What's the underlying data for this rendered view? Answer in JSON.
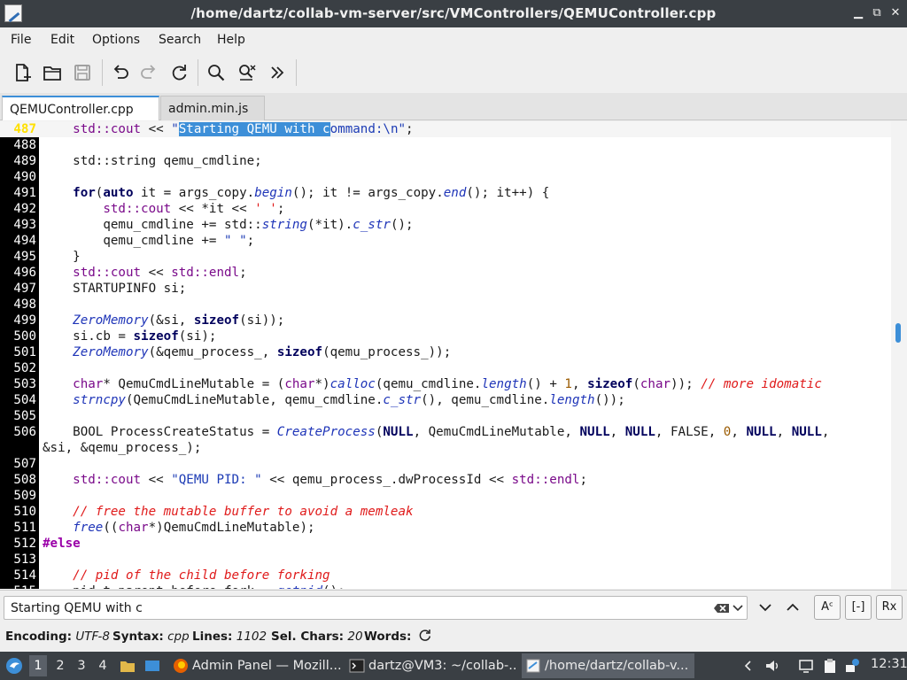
{
  "window": {
    "title": "/home/dartz/collab-vm-server/src/VMControllers/QEMUController.cpp",
    "buttons": [
      "minimize-icon",
      "maximize-icon",
      "close-icon"
    ]
  },
  "menu": [
    "File",
    "Edit",
    "Options",
    "Search",
    "Help"
  ],
  "toolbar": [
    "new-file-icon",
    "open-folder-icon",
    "save-icon",
    "undo-icon",
    "redo-icon",
    "reload-icon",
    "find-icon",
    "find-replace-icon",
    "more-icon"
  ],
  "tabs": [
    {
      "label": "QEMUController.cpp",
      "active": true
    },
    {
      "label": "admin.min.js",
      "active": false
    }
  ],
  "editor": {
    "current_line": "487",
    "lines": [
      {
        "n": "487",
        "s": "    std::cout << \"Starting QEMU with command:\\n\";"
      },
      {
        "n": "488",
        "s": ""
      },
      {
        "n": "489",
        "s": "    std::string qemu_cmdline;"
      },
      {
        "n": "490",
        "s": ""
      },
      {
        "n": "491",
        "s": "    for(auto it = args_copy.begin(); it != args_copy.end(); it++) {"
      },
      {
        "n": "492",
        "s": "        std::cout << *it << ' ';"
      },
      {
        "n": "493",
        "s": "        qemu_cmdline += std::string(*it).c_str();"
      },
      {
        "n": "494",
        "s": "        qemu_cmdline += \" \";"
      },
      {
        "n": "495",
        "s": "    }"
      },
      {
        "n": "496",
        "s": "    std::cout << std::endl;"
      },
      {
        "n": "497",
        "s": "    STARTUPINFO si;"
      },
      {
        "n": "498",
        "s": ""
      },
      {
        "n": "499",
        "s": "    ZeroMemory(&si, sizeof(si));"
      },
      {
        "n": "500",
        "s": "    si.cb = sizeof(si);"
      },
      {
        "n": "501",
        "s": "    ZeroMemory(&qemu_process_, sizeof(qemu_process_));"
      },
      {
        "n": "502",
        "s": ""
      },
      {
        "n": "503",
        "s": "    char* QemuCmdLineMutable = (char*)calloc(qemu_cmdline.length() + 1, sizeof(char)); // more idomatic"
      },
      {
        "n": "504",
        "s": "    strncpy(QemuCmdLineMutable, qemu_cmdline.c_str(), qemu_cmdline.length());"
      },
      {
        "n": "505",
        "s": ""
      },
      {
        "n": "506",
        "s": "    BOOL ProcessCreateStatus = CreateProcess(NULL, QemuCmdLineMutable, NULL, NULL, FALSE, 0, NULL, NULL,",
        "cont": "&si, &qemu_process_);"
      },
      {
        "n": "507",
        "s": ""
      },
      {
        "n": "508",
        "s": "    std::cout << \"QEMU PID: \" << qemu_process_.dwProcessId << std::endl;"
      },
      {
        "n": "509",
        "s": ""
      },
      {
        "n": "510",
        "s": "    // free the mutable buffer to avoid a memleak"
      },
      {
        "n": "511",
        "s": "    free((char*)QemuCmdLineMutable);"
      },
      {
        "n": "512",
        "s": "#else"
      },
      {
        "n": "513",
        "s": ""
      },
      {
        "n": "514",
        "s": "    // pid of the child before forking"
      },
      {
        "n": "515",
        "s": "    pid_t parent_before_fork = getpid();"
      }
    ]
  },
  "search": {
    "value": "Starting QEMU with c",
    "toggles": [
      "Aᶜ",
      "[-]",
      "Rx"
    ]
  },
  "status": {
    "encoding_label": "Encoding:",
    "encoding": "UTF-8",
    "syntax_label": "Syntax:",
    "syntax": "cpp",
    "lines_label": "Lines:",
    "lines": "1102",
    "sel_label": "Sel. Chars:",
    "sel": "20",
    "words_label": "Words:"
  },
  "taskbar": {
    "workspaces": [
      "1",
      "2",
      "3",
      "4"
    ],
    "tasks": [
      {
        "label": "Admin Panel — Mozill...",
        "icon": "firefox-icon"
      },
      {
        "label": "dartz@VM3: ~/collab-...",
        "icon": "terminal-icon"
      },
      {
        "label": "/home/dartz/collab-v...",
        "icon": "editor-icon"
      }
    ],
    "clock": "12:31"
  },
  "colors": {
    "accent": "#3d8fd8",
    "gutter": "#000000",
    "current_line_number": "#ffe000",
    "comment": "#e01b1b",
    "keyword": "#7a0a8a"
  }
}
